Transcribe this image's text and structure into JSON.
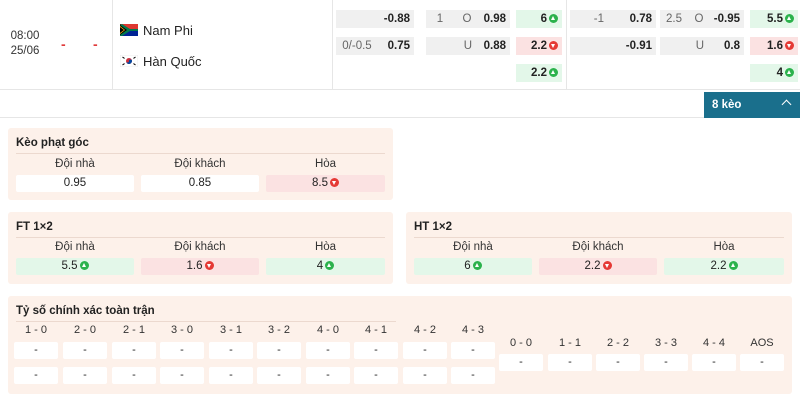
{
  "match": {
    "time": "08:00",
    "date": "25/06",
    "home_score": "-",
    "away_score": "-",
    "home_team": "Nam Phi",
    "away_team": "Hàn Quốc",
    "home_flag": "south-africa-flag-icon",
    "away_flag": "south-korea-flag-icon"
  },
  "odds": {
    "ft_handicap_home": "-0.88",
    "ft_handicap_line": "0/-0.5",
    "ft_handicap_away": "0.75",
    "ft_ou_line": "1",
    "ft_ou_over_label": "O",
    "ft_ou_over": "0.98",
    "ft_ou_under_label": "U",
    "ft_ou_under": "0.88",
    "ft_1x2_home": "6",
    "ft_1x2_away": "2.2",
    "ft_1x2_draw": "2.2",
    "ht_handicap_line": "-1",
    "ht_handicap_home": "0.78",
    "ht_handicap_away": "-0.91",
    "ht_ou_line": "2.5",
    "ht_ou_over_label": "O",
    "ht_ou_over": "-0.95",
    "ht_ou_under_label": "U",
    "ht_ou_under": "0.8",
    "ht_1x2_home": "5.5",
    "ht_1x2_away": "1.6",
    "ht_1x2_draw": "4"
  },
  "more_button": "8 kèo",
  "corner": {
    "title": "Kèo phạt góc",
    "home_label": "Đội nhà",
    "away_label": "Đội khách",
    "draw_label": "Hòa",
    "home": "0.95",
    "away": "0.85",
    "draw": "8.5"
  },
  "ft1x2": {
    "title": "FT 1×2",
    "home_label": "Đội nhà",
    "away_label": "Đội khách",
    "draw_label": "Hòa",
    "home": "5.5",
    "away": "1.6",
    "draw": "4"
  },
  "ht1x2": {
    "title": "HT 1×2",
    "home_label": "Đội nhà",
    "away_label": "Đội khách",
    "draw_label": "Hòa",
    "home": "6",
    "away": "2.2",
    "draw": "2.2"
  },
  "correct_score": {
    "title": "Tỷ số chính xác toàn trận",
    "left": [
      {
        "label": "1 - 0",
        "a": "-",
        "b": "-"
      },
      {
        "label": "2 - 0",
        "a": "-",
        "b": "-"
      },
      {
        "label": "2 - 1",
        "a": "-",
        "b": "-"
      },
      {
        "label": "3 - 0",
        "a": "-",
        "b": "-"
      },
      {
        "label": "3 - 1",
        "a": "-",
        "b": "-"
      },
      {
        "label": "3 - 2",
        "a": "-",
        "b": "-"
      },
      {
        "label": "4 - 0",
        "a": "-",
        "b": "-"
      },
      {
        "label": "4 - 1",
        "a": "-",
        "b": "-"
      },
      {
        "label": "4 - 2",
        "a": "-",
        "b": "-"
      },
      {
        "label": "4 - 3",
        "a": "-",
        "b": "-"
      }
    ],
    "right": [
      {
        "label": "0 - 0",
        "v": "-"
      },
      {
        "label": "1 - 1",
        "v": "-"
      },
      {
        "label": "2 - 2",
        "v": "-"
      },
      {
        "label": "3 - 3",
        "v": "-"
      },
      {
        "label": "4 - 4",
        "v": "-"
      },
      {
        "label": "AOS",
        "v": "-"
      }
    ]
  },
  "colors": {
    "accent": "#1a6f8c",
    "panel_bg": "#fdf1ea",
    "up": "#2bb24c",
    "down": "#e53935",
    "score_dash": "#e03b3b"
  }
}
